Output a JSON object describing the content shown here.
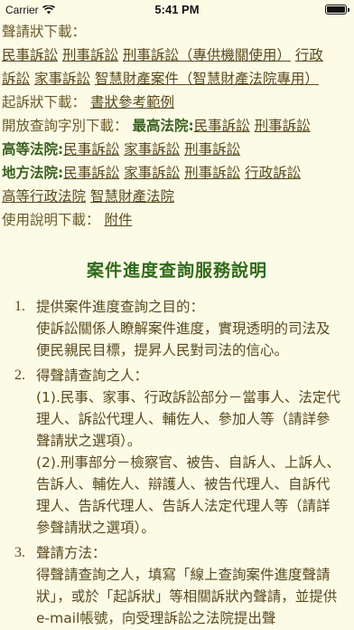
{
  "status": {
    "carrier": "Carrier",
    "time": "5:41 PM",
    "battery_level": 1.0
  },
  "links": {
    "petition_label": "聲請狀下載：",
    "petition_items": [
      "民事訴訟",
      "刑事訴訟",
      "刑事訴訟（專供機關使用）",
      "行政",
      "訴訟",
      "家事訴訟",
      "智慧財產案件（智慧財產法院專用）"
    ],
    "complaint_label": "起訴狀下載：",
    "complaint_item": "書狀參考範例",
    "query_label": "開放查詢字別下載：",
    "supreme_label": "最高法院:",
    "supreme_items": [
      "民事訴訟",
      "刑事訴訟"
    ],
    "high_label": "高等法院:",
    "high_items": [
      "民事訴訟",
      "家事訴訟",
      "刑事訴訟"
    ],
    "district_label": "地方法院:",
    "district_items": [
      "民事訴訟",
      "家事訴訟",
      "刑事訴訟",
      "行政訴訟"
    ],
    "admin_items": [
      "高等行政法院",
      "智慧財產法院"
    ],
    "manual_label": "使用說明下載：",
    "manual_item": "附件"
  },
  "section_title": "案件進度查詢服務說明",
  "items": [
    {
      "num": "1.",
      "head": "提供案件進度查詢之目的：",
      "paras": [
        "使訴訟關係人瞭解案件進度，實現透明的司法及便民親民目標，提昇人民對司法的信心。"
      ]
    },
    {
      "num": "2.",
      "head": "得聲請查詢之人：",
      "paras": [
        "(1).民事、家事、行政訴訟部分－當事人、法定代理人、訴訟代理人、輔佐人、參加人等（請詳參聲請狀之選項）。",
        "(2).刑事部分－檢察官、被告、自訴人、上訴人、告訴人、輔佐人、辯護人、被告代理人、自訴代理人、告訴代理人、告訴人法定代理人等（請詳參聲請狀之選項）。"
      ]
    },
    {
      "num": "3.",
      "head": "聲請方法：",
      "paras": [
        "得聲請查詢之人，填寫「線上查詢案件進度聲請狀」，或於「起訴狀」等相關訴狀內聲請，並提供e-mail帳號，向受理訴訟之法院提出聲"
      ]
    }
  ]
}
